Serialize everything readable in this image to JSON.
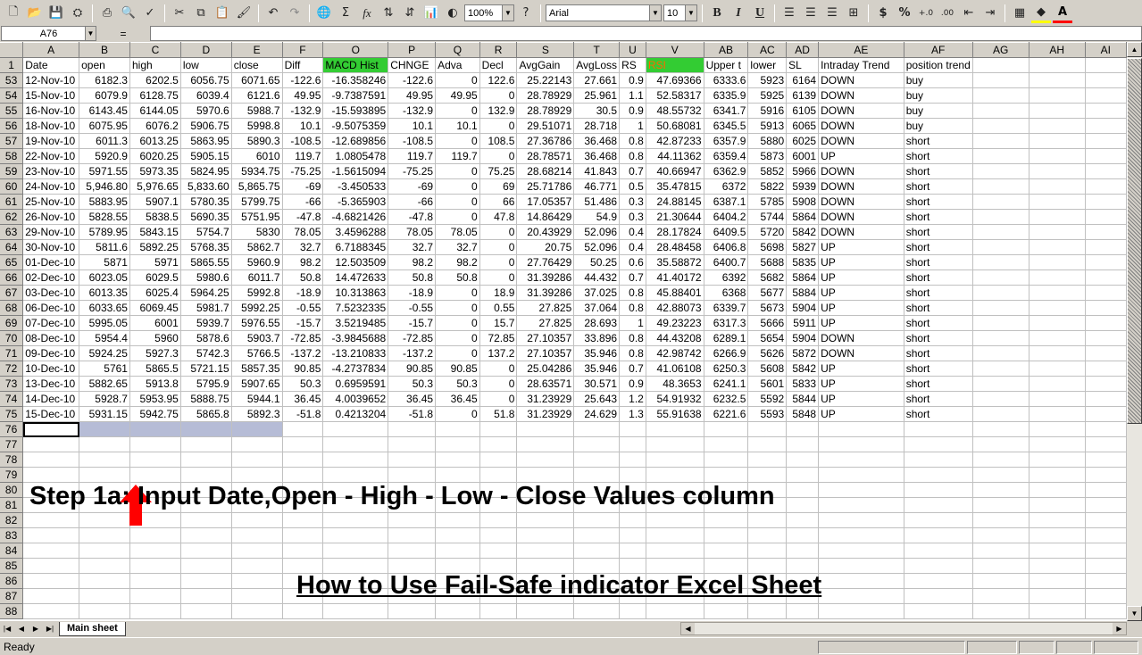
{
  "toolbar": {
    "zoom": "100%",
    "font_name": "Arial",
    "font_size": "10",
    "bold_label": "B",
    "italic_label": "I",
    "underline_label": "U",
    "currency_label": "$",
    "percent_label": "%",
    "accent_fill": "#ffff00",
    "accent_font": "#ff0000"
  },
  "formula_bar": {
    "name_box": "A76",
    "equals": "=",
    "formula": ""
  },
  "columns": [
    "A",
    "B",
    "C",
    "D",
    "E",
    "F",
    "O",
    "P",
    "Q",
    "R",
    "S",
    "T",
    "U",
    "V",
    "AB",
    "AC",
    "AD",
    "AE",
    "AF",
    "AG",
    "AH",
    "AI"
  ],
  "header_row": {
    "row_number": "1",
    "cells": [
      "Date",
      "open",
      "high",
      "low",
      "close",
      "Diff",
      "MACD Hist",
      "CHNGE",
      "Adva",
      "Decl",
      "AvgGain",
      "AvgLoss",
      "RS",
      "RSI",
      "Upper t",
      "lower",
      "SL",
      "Intraday Trend",
      "position trend",
      "",
      "",
      ""
    ]
  },
  "rows": [
    {
      "n": "53",
      "c": [
        "12-Nov-10",
        "6182.3",
        "6202.5",
        "6056.75",
        "6071.65",
        "-122.6",
        "-16.358246",
        "-122.6",
        "0",
        "122.6",
        "25.22143",
        "27.661",
        "0.9",
        "47.69366",
        "6333.6",
        "5923",
        "6164",
        "DOWN",
        "buy",
        "",
        "",
        ""
      ]
    },
    {
      "n": "54",
      "c": [
        "15-Nov-10",
        "6079.9",
        "6128.75",
        "6039.4",
        "6121.6",
        "49.95",
        "-9.7387591",
        "49.95",
        "49.95",
        "0",
        "28.78929",
        "25.961",
        "1.1",
        "52.58317",
        "6335.9",
        "5925",
        "6139",
        "DOWN",
        "buy",
        "",
        "",
        ""
      ]
    },
    {
      "n": "55",
      "c": [
        "16-Nov-10",
        "6143.45",
        "6144.05",
        "5970.6",
        "5988.7",
        "-132.9",
        "-15.593895",
        "-132.9",
        "0",
        "132.9",
        "28.78929",
        "30.5",
        "0.9",
        "48.55732",
        "6341.7",
        "5916",
        "6105",
        "DOWN",
        "buy",
        "",
        "",
        ""
      ]
    },
    {
      "n": "56",
      "c": [
        "18-Nov-10",
        "6075.95",
        "6076.2",
        "5906.75",
        "5998.8",
        "10.1",
        "-9.5075359",
        "10.1",
        "10.1",
        "0",
        "29.51071",
        "28.718",
        "1",
        "50.68081",
        "6345.5",
        "5913",
        "6065",
        "DOWN",
        "buy",
        "",
        "",
        ""
      ]
    },
    {
      "n": "57",
      "c": [
        "19-Nov-10",
        "6011.3",
        "6013.25",
        "5863.95",
        "5890.3",
        "-108.5",
        "-12.689856",
        "-108.5",
        "0",
        "108.5",
        "27.36786",
        "36.468",
        "0.8",
        "42.87233",
        "6357.9",
        "5880",
        "6025",
        "DOWN",
        "short",
        "",
        "",
        ""
      ]
    },
    {
      "n": "58",
      "c": [
        "22-Nov-10",
        "5920.9",
        "6020.25",
        "5905.15",
        "6010",
        "119.7",
        "1.0805478",
        "119.7",
        "119.7",
        "0",
        "28.78571",
        "36.468",
        "0.8",
        "44.11362",
        "6359.4",
        "5873",
        "6001",
        "UP",
        "short",
        "",
        "",
        ""
      ]
    },
    {
      "n": "59",
      "c": [
        "23-Nov-10",
        "5971.55",
        "5973.35",
        "5824.95",
        "5934.75",
        "-75.25",
        "-1.5615094",
        "-75.25",
        "0",
        "75.25",
        "28.68214",
        "41.843",
        "0.7",
        "40.66947",
        "6362.9",
        "5852",
        "5966",
        "DOWN",
        "short",
        "",
        "",
        ""
      ]
    },
    {
      "n": "60",
      "c": [
        "24-Nov-10",
        "5,946.80",
        "5,976.65",
        "5,833.60",
        "5,865.75",
        "-69",
        "-3.450533",
        "-69",
        "0",
        "69",
        "25.71786",
        "46.771",
        "0.5",
        "35.47815",
        "6372",
        "5822",
        "5939",
        "DOWN",
        "short",
        "",
        "",
        ""
      ]
    },
    {
      "n": "61",
      "c": [
        "25-Nov-10",
        "5883.95",
        "5907.1",
        "5780.35",
        "5799.75",
        "-66",
        "-5.365903",
        "-66",
        "0",
        "66",
        "17.05357",
        "51.486",
        "0.3",
        "24.88145",
        "6387.1",
        "5785",
        "5908",
        "DOWN",
        "short",
        "",
        "",
        ""
      ]
    },
    {
      "n": "62",
      "c": [
        "26-Nov-10",
        "5828.55",
        "5838.5",
        "5690.35",
        "5751.95",
        "-47.8",
        "-4.6821426",
        "-47.8",
        "0",
        "47.8",
        "14.86429",
        "54.9",
        "0.3",
        "21.30644",
        "6404.2",
        "5744",
        "5864",
        "DOWN",
        "short",
        "",
        "",
        ""
      ]
    },
    {
      "n": "63",
      "c": [
        "29-Nov-10",
        "5789.95",
        "5843.15",
        "5754.7",
        "5830",
        "78.05",
        "3.4596288",
        "78.05",
        "78.05",
        "0",
        "20.43929",
        "52.096",
        "0.4",
        "28.17824",
        "6409.5",
        "5720",
        "5842",
        "DOWN",
        "short",
        "",
        "",
        ""
      ]
    },
    {
      "n": "64",
      "c": [
        "30-Nov-10",
        "5811.6",
        "5892.25",
        "5768.35",
        "5862.7",
        "32.7",
        "6.7188345",
        "32.7",
        "32.7",
        "0",
        "20.75",
        "52.096",
        "0.4",
        "28.48458",
        "6406.8",
        "5698",
        "5827",
        "UP",
        "short",
        "",
        "",
        ""
      ]
    },
    {
      "n": "65",
      "c": [
        "01-Dec-10",
        "5871",
        "5971",
        "5865.55",
        "5960.9",
        "98.2",
        "12.503509",
        "98.2",
        "98.2",
        "0",
        "27.76429",
        "50.25",
        "0.6",
        "35.58872",
        "6400.7",
        "5688",
        "5835",
        "UP",
        "short",
        "",
        "",
        ""
      ]
    },
    {
      "n": "66",
      "c": [
        "02-Dec-10",
        "6023.05",
        "6029.5",
        "5980.6",
        "6011.7",
        "50.8",
        "14.472633",
        "50.8",
        "50.8",
        "0",
        "31.39286",
        "44.432",
        "0.7",
        "41.40172",
        "6392",
        "5682",
        "5864",
        "UP",
        "short",
        "",
        "",
        ""
      ]
    },
    {
      "n": "67",
      "c": [
        "03-Dec-10",
        "6013.35",
        "6025.4",
        "5964.25",
        "5992.8",
        "-18.9",
        "10.313863",
        "-18.9",
        "0",
        "18.9",
        "31.39286",
        "37.025",
        "0.8",
        "45.88401",
        "6368",
        "5677",
        "5884",
        "UP",
        "short",
        "",
        "",
        ""
      ]
    },
    {
      "n": "68",
      "c": [
        "06-Dec-10",
        "6033.65",
        "6069.45",
        "5981.7",
        "5992.25",
        "-0.55",
        "7.5232335",
        "-0.55",
        "0",
        "0.55",
        "27.825",
        "37.064",
        "0.8",
        "42.88073",
        "6339.7",
        "5673",
        "5904",
        "UP",
        "short",
        "",
        "",
        ""
      ]
    },
    {
      "n": "69",
      "c": [
        "07-Dec-10",
        "5995.05",
        "6001",
        "5939.7",
        "5976.55",
        "-15.7",
        "3.5219485",
        "-15.7",
        "0",
        "15.7",
        "27.825",
        "28.693",
        "1",
        "49.23223",
        "6317.3",
        "5666",
        "5911",
        "UP",
        "short",
        "",
        "",
        ""
      ]
    },
    {
      "n": "70",
      "c": [
        "08-Dec-10",
        "5954.4",
        "5960",
        "5878.6",
        "5903.7",
        "-72.85",
        "-3.9845688",
        "-72.85",
        "0",
        "72.85",
        "27.10357",
        "33.896",
        "0.8",
        "44.43208",
        "6289.1",
        "5654",
        "5904",
        "DOWN",
        "short",
        "",
        "",
        ""
      ]
    },
    {
      "n": "71",
      "c": [
        "09-Dec-10",
        "5924.25",
        "5927.3",
        "5742.3",
        "5766.5",
        "-137.2",
        "-13.210833",
        "-137.2",
        "0",
        "137.2",
        "27.10357",
        "35.946",
        "0.8",
        "42.98742",
        "6266.9",
        "5626",
        "5872",
        "DOWN",
        "short",
        "",
        "",
        ""
      ]
    },
    {
      "n": "72",
      "c": [
        "10-Dec-10",
        "5761",
        "5865.5",
        "5721.15",
        "5857.35",
        "90.85",
        "-4.2737834",
        "90.85",
        "90.85",
        "0",
        "25.04286",
        "35.946",
        "0.7",
        "41.06108",
        "6250.3",
        "5608",
        "5842",
        "UP",
        "short",
        "",
        "",
        ""
      ]
    },
    {
      "n": "73",
      "c": [
        "13-Dec-10",
        "5882.65",
        "5913.8",
        "5795.9",
        "5907.65",
        "50.3",
        "0.6959591",
        "50.3",
        "50.3",
        "0",
        "28.63571",
        "30.571",
        "0.9",
        "48.3653",
        "6241.1",
        "5601",
        "5833",
        "UP",
        "short",
        "",
        "",
        ""
      ]
    },
    {
      "n": "74",
      "c": [
        "14-Dec-10",
        "5928.7",
        "5953.95",
        "5888.75",
        "5944.1",
        "36.45",
        "4.0039652",
        "36.45",
        "36.45",
        "0",
        "31.23929",
        "25.643",
        "1.2",
        "54.91932",
        "6232.5",
        "5592",
        "5844",
        "UP",
        "short",
        "",
        "",
        ""
      ]
    },
    {
      "n": "75",
      "c": [
        "15-Dec-10",
        "5931.15",
        "5942.75",
        "5865.8",
        "5892.3",
        "-51.8",
        "0.4213204",
        "-51.8",
        "0",
        "51.8",
        "31.23929",
        "24.629",
        "1.3",
        "55.91638",
        "6221.6",
        "5593",
        "5848",
        "UP",
        "short",
        "",
        "",
        ""
      ]
    }
  ],
  "empty_rows": [
    "76",
    "77",
    "78",
    "79",
    "80",
    "81",
    "82",
    "83",
    "84",
    "85",
    "86",
    "87",
    "88"
  ],
  "annotations": {
    "step_text": "Step 1a: Input Date,Open - High - Low - Close Values column",
    "howto_text": "How to Use Fail-Safe indicator Excel Sheet",
    "arrow_color": "#ff0000"
  },
  "sheet_tabs": [
    "Main sheet"
  ],
  "status": {
    "text": "Ready"
  },
  "colors": {
    "header_green": "#33cc33",
    "rsi_text": "#ff6600",
    "selection": "#b6bcd6"
  }
}
